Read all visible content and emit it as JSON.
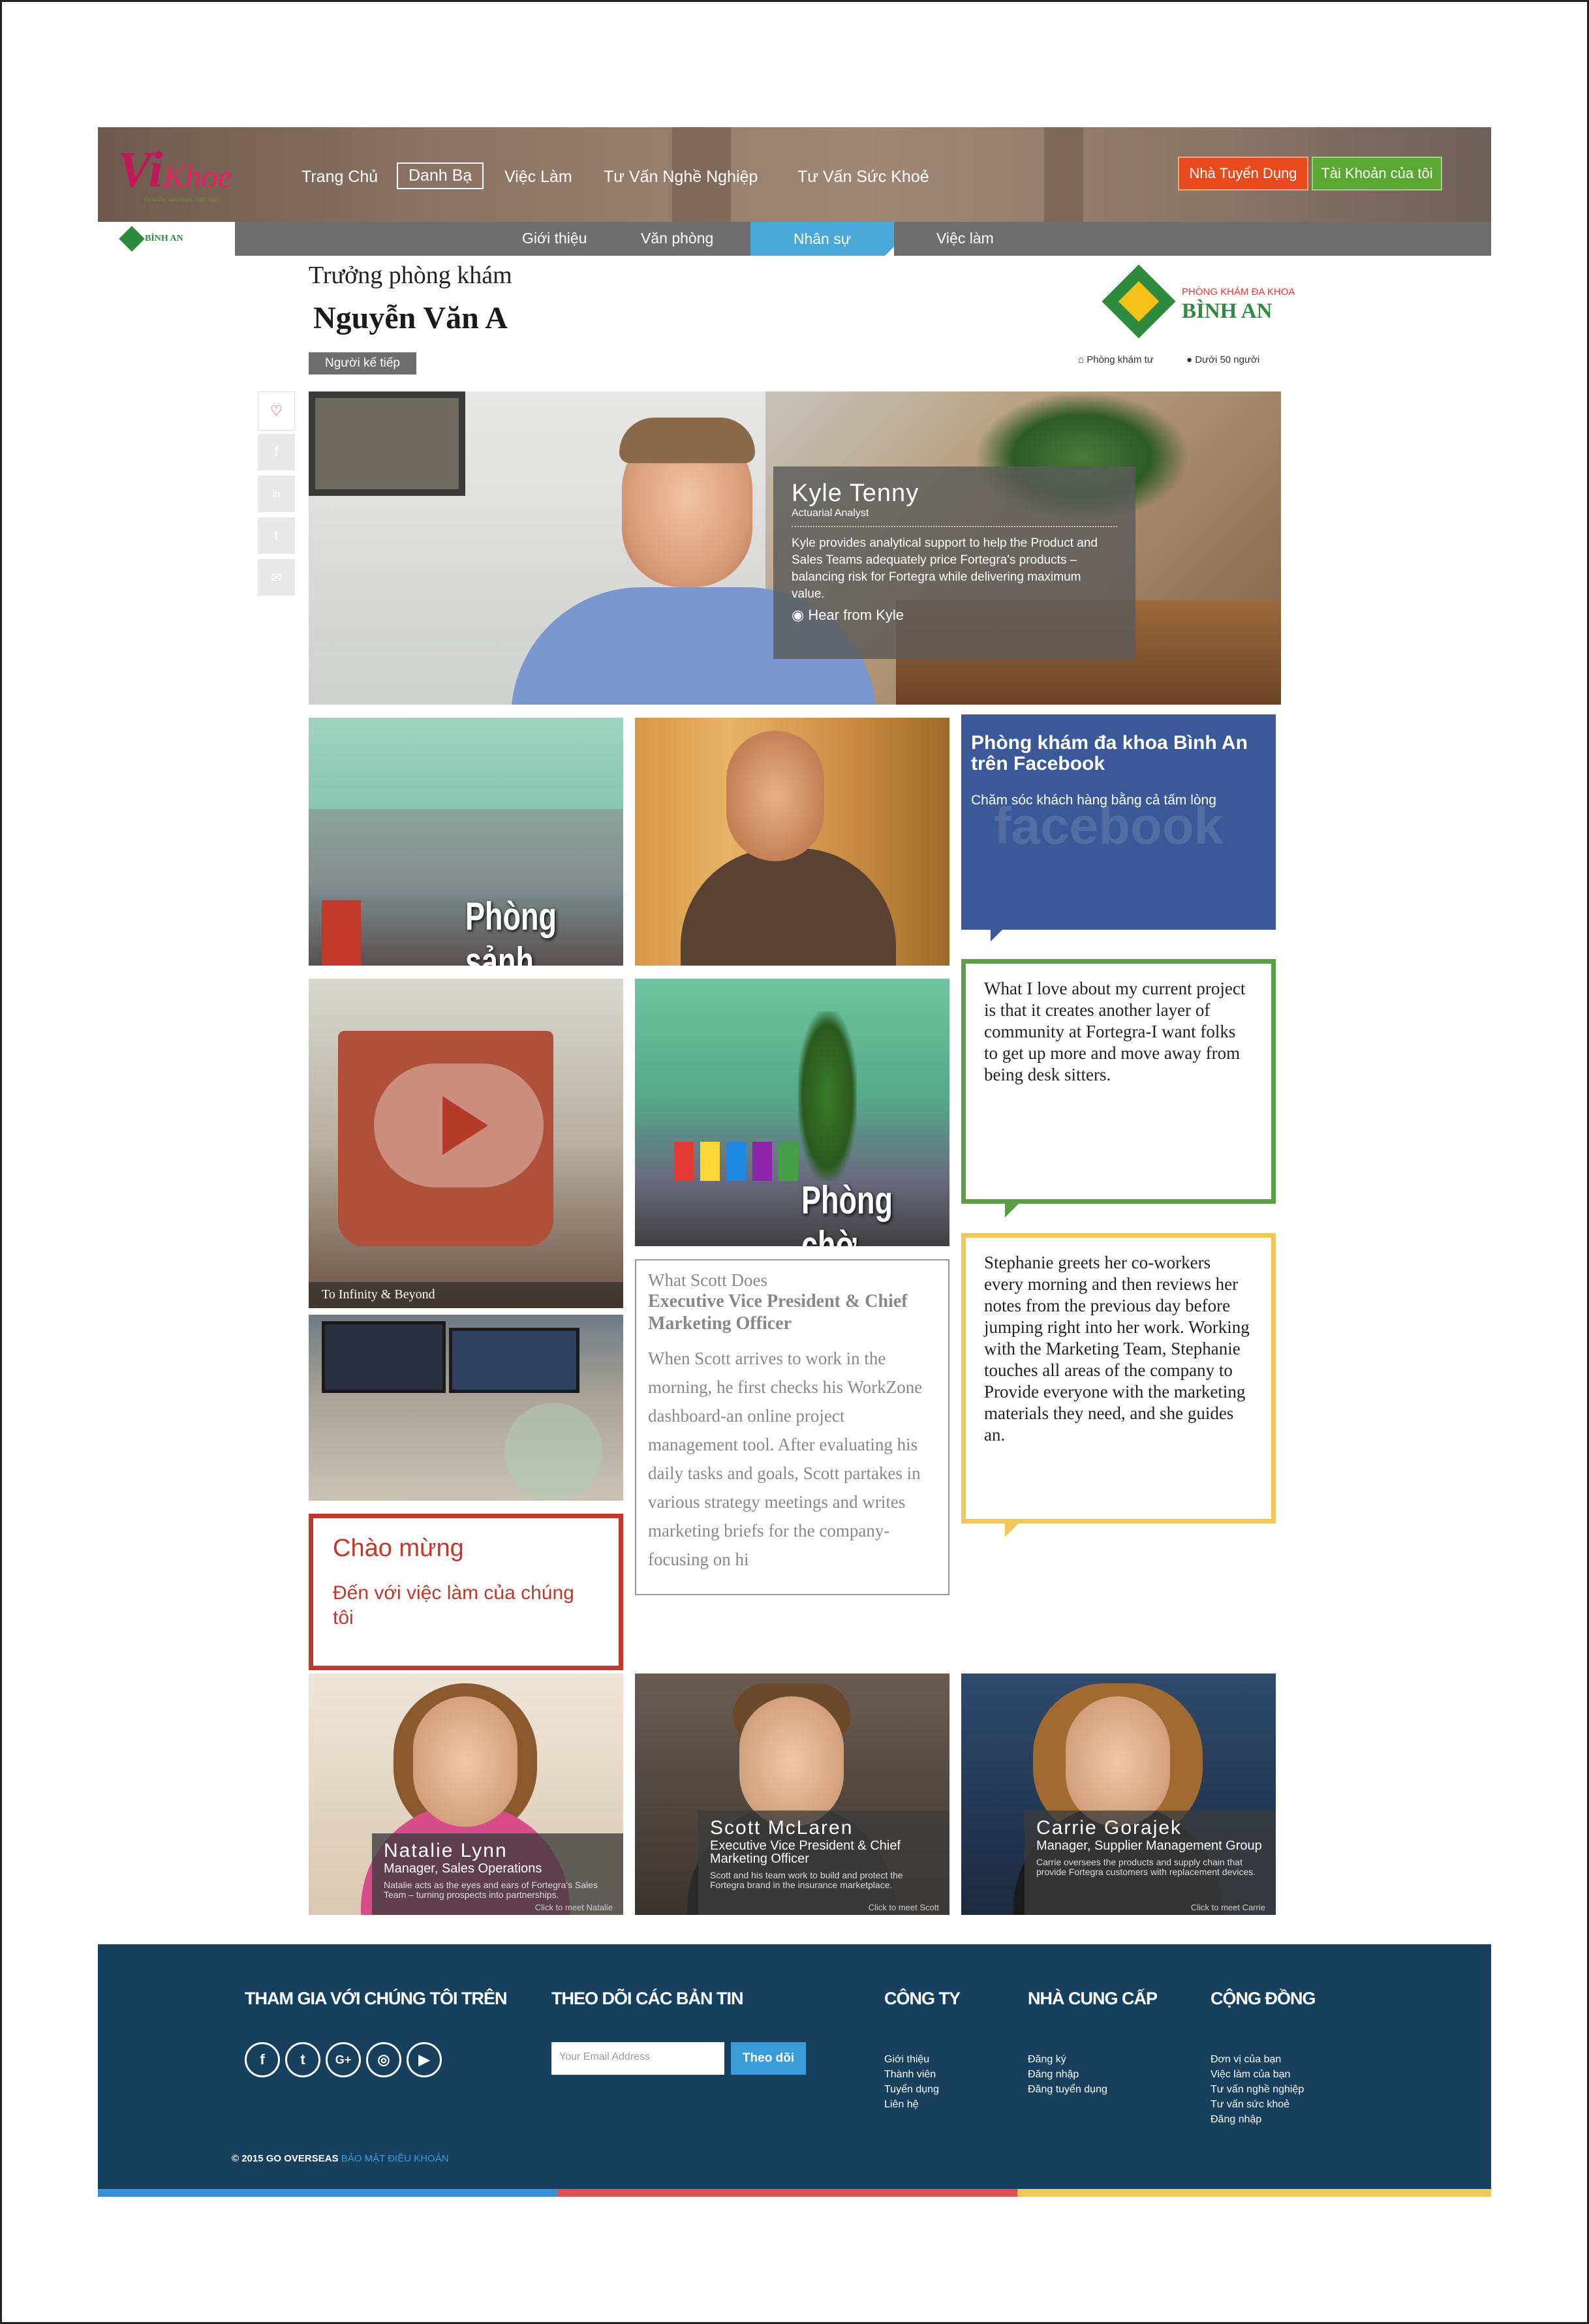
{
  "header": {
    "logo_text_v": "Vi",
    "logo_text_k": "Khoe",
    "logo_tagline": "Tư khỏe, làm khỏe, Việt Nam",
    "nav": [
      "Trang Chủ",
      "Danh Bạ",
      "Việc Làm",
      "Tư Vấn Nghề Nghiệp",
      "Tư Vấn Sức Khoẻ"
    ],
    "employer_button": "Nhà Tuyển Dụng",
    "account_button": "Tài Khoản của tôi"
  },
  "subnav": {
    "logo_text": "BÌNH AN",
    "items": [
      "Giới thiệu",
      "Văn phòng",
      "Nhân sự",
      "Việc làm"
    ],
    "active": "Nhân sự"
  },
  "profile": {
    "role": "Trưởng phòng khám",
    "name": "Nguyễn Văn A",
    "next_button": "Người kế tiếp",
    "company_line1": "PHÒNG KHÁM ĐA KHOA",
    "company_line2": "BÌNH AN",
    "meta_type": "Phòng khám tư",
    "meta_size": "Dưới 50 người"
  },
  "share": {
    "icons": [
      "heart-icon",
      "facebook-icon",
      "linkedin-icon",
      "twitter-icon",
      "email-icon"
    ],
    "glyphs": [
      "♡",
      "f",
      "in",
      "t",
      "✉"
    ]
  },
  "hero": {
    "name": "Kyle Tenny",
    "role": "Actuarial Analyst",
    "description": "Kyle provides analytical support to help the Product and Sales Teams adequately price Fortegra's products – balancing risk for Fortegra while delivering maximum value.",
    "hear": "Hear from Kyle"
  },
  "tiles": {
    "lobby": "Phòng sảnh",
    "waiting": "Phòng chờ",
    "video_caption": "To Infinity & Beyond",
    "fb_title": "Phòng khám đa khoa Bình An trên Facebook",
    "fb_subtitle": "Chăm sóc khách hàng bằng cả tấm lòng",
    "fb_bg": "facebook",
    "quote1": "What I love about my current project is that it creates another layer of community at Fortegra-I want folks to get up more and move away from being desk sitters.",
    "quote2": "Stephanie greets her co-workers every morning and then reviews her notes from the previous day before jumping right into her work. Working with the Marketing Team, Stephanie touches all areas of the company to Provide everyone with the marketing materials they need, and she guides an.",
    "scott_heading": "What Scott Does",
    "scott_title": "Executive Vice President & Chief Marketing Officer",
    "scott_body": "When Scott arrives to work in the morning, he first checks his WorkZone dashboard-an online project management tool. After evaluating his daily tasks and goals, Scott partakes in various strategy meetings and writes marketing briefs for the company-focusing on hi",
    "welcome_title": "Chào mừng",
    "welcome_sub": "Đến với việc làm của chúng tôi"
  },
  "people": [
    {
      "name": "Natalie Lynn",
      "role": "Manager, Sales Operations",
      "desc": "Natalie acts as the eyes and ears of Fortegra's Sales Team – turning prospects into partnerships.",
      "cta": "Click to meet Natalie"
    },
    {
      "name": "Scott McLaren",
      "role": "Executive Vice President & Chief Marketing Officer",
      "desc": "Scott and his team work to build and protect the Fortegra brand in the insurance marketplace.",
      "cta": "Click to meet Scott"
    },
    {
      "name": "Carrie Gorajek",
      "role": "Manager, Supplier Management Group",
      "desc": "Carrie oversees the products and supply chain that provide Fortegra customers with replacement devices.",
      "cta": "Click to meet Carrie"
    }
  ],
  "footer": {
    "join_heading": "THAM GIA VỚI CHÚNG TÔI TRÊN",
    "news_heading": "THEO DÕI CÁC BẢN TIN",
    "company_heading": "CÔNG TY",
    "supplier_heading": "NHÀ CUNG CẤP",
    "community_heading": "CỘNG ĐỒNG",
    "social_glyphs": [
      "f",
      "t",
      "G+",
      "◎",
      "▶"
    ],
    "email_placeholder": "Your Email Address",
    "subscribe": "Theo dõi",
    "company_links": [
      "Giới thiệu",
      "Thành viên",
      "Tuyển dụng",
      "Liên hệ"
    ],
    "supplier_links": [
      "Đăng ký",
      "Đăng nhập",
      "Đăng tuyển dụng"
    ],
    "community_links": [
      "Đơn vị của bạn",
      "Việc làm của bạn",
      "Tư vấn nghề nghiệp",
      "Tư vấn sức khoẻ",
      "Đăng nhập"
    ],
    "copyright": "© 2015 GO OVERSEAS",
    "terms": "BẢO MẬT ĐIỀU KHOẢN"
  }
}
